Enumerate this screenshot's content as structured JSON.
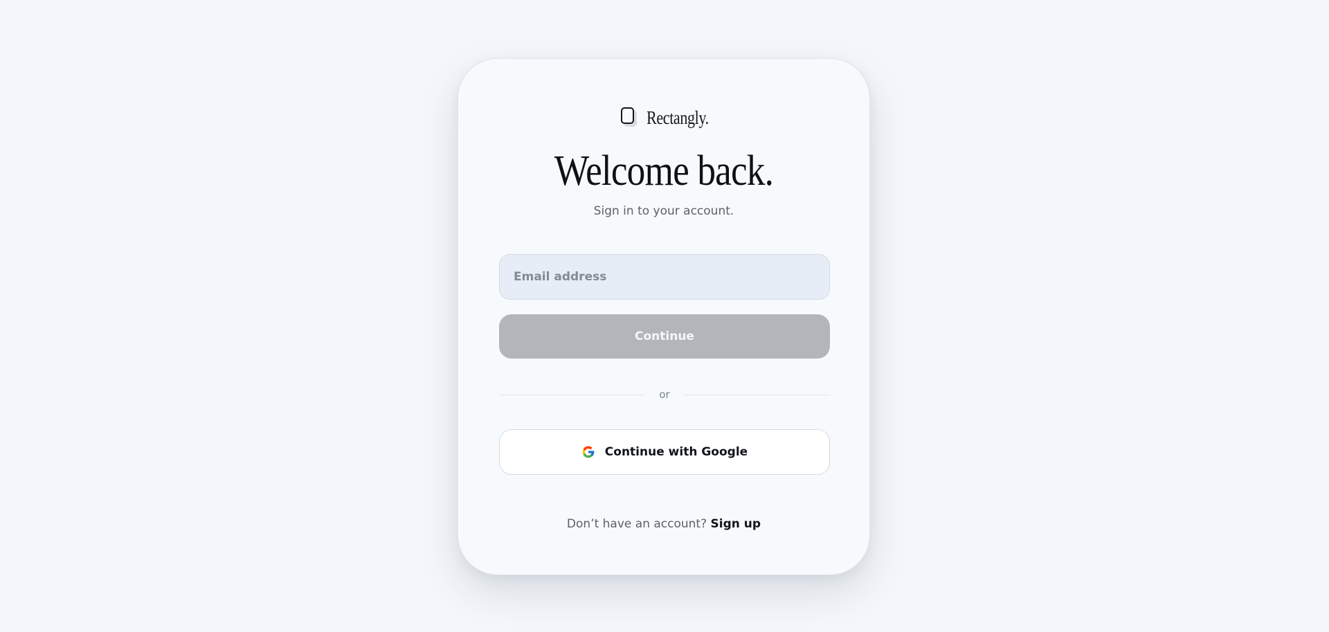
{
  "brand": {
    "name": "Rectangly.",
    "logo_icon": "rectangle-logo-icon"
  },
  "heading": {
    "title": "Welcome back.",
    "subtitle": "Sign in to your account."
  },
  "form": {
    "email_placeholder": "Email address",
    "email_value": "",
    "continue_label": "Continue",
    "continue_state": "disabled"
  },
  "divider": {
    "label": "or"
  },
  "social": {
    "google_label": "Continue with Google",
    "google_icon": "google-icon"
  },
  "footer": {
    "prompt": "Don’t have an account?",
    "signup_label": "Sign up"
  },
  "colors": {
    "page_background": "#f3f6fa",
    "card_background": "#f7fafd",
    "input_background": "#e7edf6",
    "button_disabled": "#b2b5b9",
    "text_primary": "#111418",
    "text_secondary": "#5b6068"
  }
}
